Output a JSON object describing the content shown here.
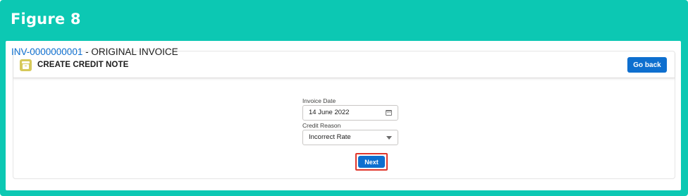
{
  "figure": {
    "title": "Figure 8"
  },
  "header": {
    "icon": "archive-box-icon",
    "title": "CREATE CREDIT NOTE",
    "go_back_label": "Go back"
  },
  "invoice": {
    "number": "INV-0000000001",
    "separator": " - ",
    "description": "ORIGINAL INVOICE"
  },
  "form": {
    "invoice_date": {
      "label": "Invoice Date",
      "value": "14 June 2022",
      "icon": "calendar-icon"
    },
    "credit_reason": {
      "label": "Credit Reason",
      "value": "Incorrect Rate",
      "icon": "chevron-down-icon"
    },
    "next_label": "Next"
  },
  "colors": {
    "frame": "#0cc8b3",
    "primary_button": "#0e6fcf",
    "link": "#0e6fcf",
    "highlight": "#e0362b",
    "header_icon": "#d6c95a"
  }
}
